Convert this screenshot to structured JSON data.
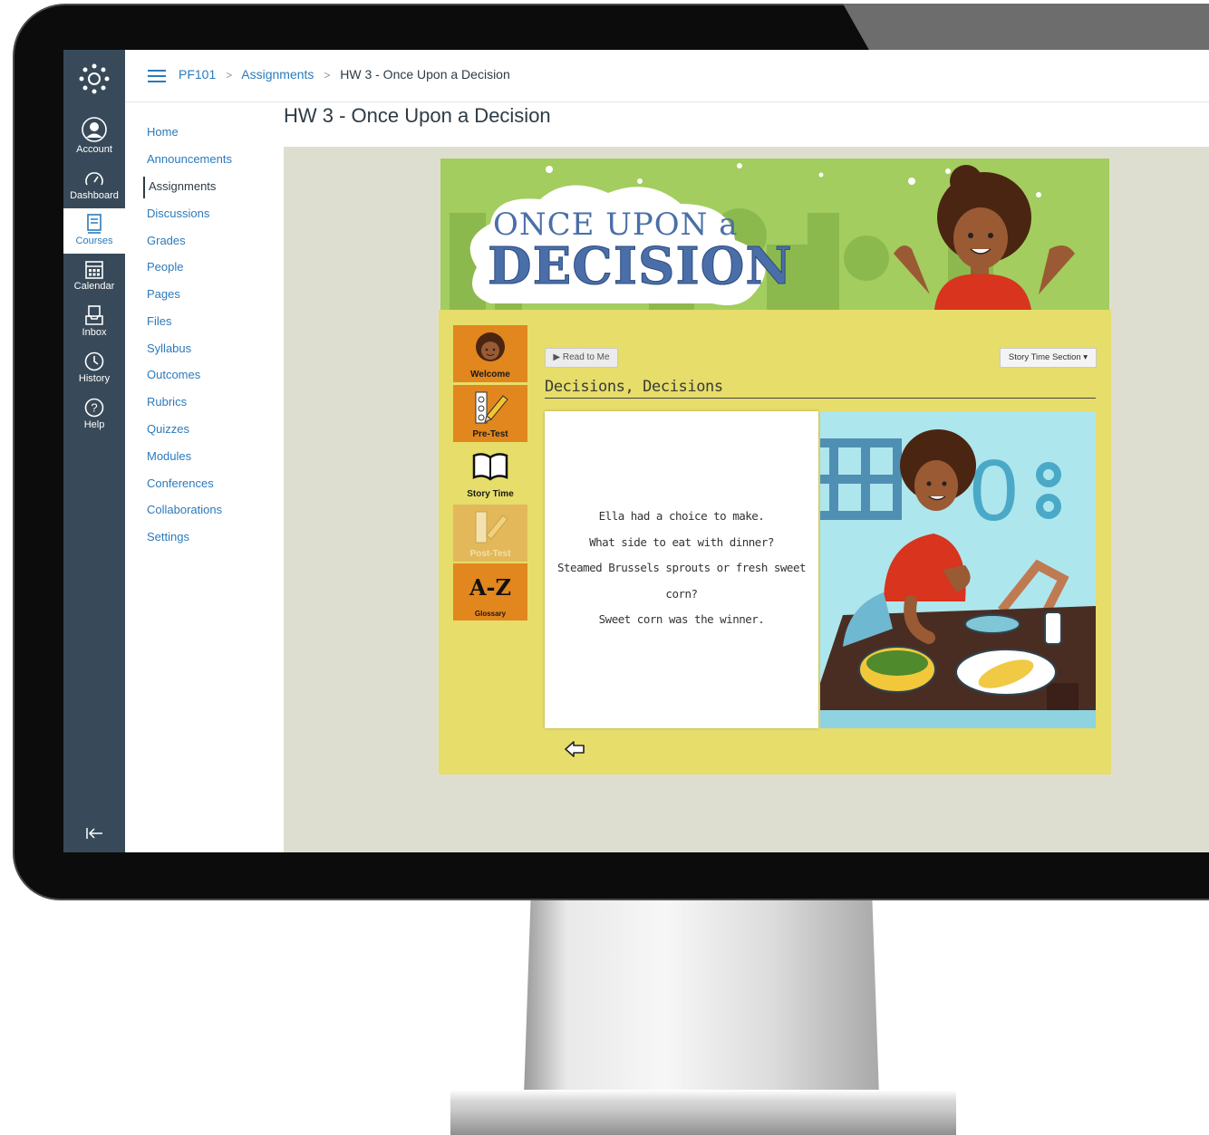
{
  "global_nav": {
    "items": [
      {
        "label": "Account",
        "icon": "account-icon"
      },
      {
        "label": "Dashboard",
        "icon": "dashboard-icon"
      },
      {
        "label": "Courses",
        "icon": "courses-icon"
      },
      {
        "label": "Calendar",
        "icon": "calendar-icon"
      },
      {
        "label": "Inbox",
        "icon": "inbox-icon"
      },
      {
        "label": "History",
        "icon": "history-icon"
      },
      {
        "label": "Help",
        "icon": "help-icon"
      }
    ],
    "active": "Courses",
    "colors": {
      "background": "#384a59",
      "accent": "#2b7abc"
    }
  },
  "breadcrumb": {
    "course": "PF101",
    "section": "Assignments",
    "current": "HW 3 - Once Upon a Decision",
    "separator": ">"
  },
  "course_nav": {
    "items": [
      {
        "label": "Home",
        "hidden": false
      },
      {
        "label": "Announcements",
        "hidden": true
      },
      {
        "label": "Assignments",
        "hidden": false
      },
      {
        "label": "Discussions",
        "hidden": false
      },
      {
        "label": "Grades",
        "hidden": false
      },
      {
        "label": "People",
        "hidden": false
      },
      {
        "label": "Pages",
        "hidden": true
      },
      {
        "label": "Files",
        "hidden": true
      },
      {
        "label": "Syllabus",
        "hidden": false
      },
      {
        "label": "Outcomes",
        "hidden": true
      },
      {
        "label": "Rubrics",
        "hidden": false
      },
      {
        "label": "Quizzes",
        "hidden": true
      },
      {
        "label": "Modules",
        "hidden": true
      },
      {
        "label": "Conferences",
        "hidden": false
      },
      {
        "label": "Collaborations",
        "hidden": false
      },
      {
        "label": "Settings",
        "hidden": false
      }
    ],
    "active": "Assignments"
  },
  "page": {
    "title": "HW 3 - Once Upon a Decision"
  },
  "module": {
    "banner_title_line1": "ONCE UPON a",
    "banner_title_line2": "DECISION",
    "tools": [
      {
        "label": "Welcome",
        "state": "available"
      },
      {
        "label": "Pre-Test",
        "state": "available"
      },
      {
        "label": "Story Time",
        "state": "current"
      },
      {
        "label": "Post-Test",
        "state": "disabled"
      },
      {
        "label": "Glossary",
        "icon_text": "A-Z",
        "state": "available"
      }
    ],
    "read_button": "▶ Read to Me",
    "section_select": "Story Time Section ▾",
    "story_heading": "Decisions, Decisions",
    "story_lines": [
      "Ella had a choice to make.",
      "What side to eat with dinner?",
      "Steamed Brussels sprouts or fresh sweet",
      "corn?",
      "Sweet corn was the winner."
    ],
    "colors": {
      "panel": "#e6dd6a",
      "tool": "#e2861e",
      "banner": "#9bc65a"
    }
  }
}
